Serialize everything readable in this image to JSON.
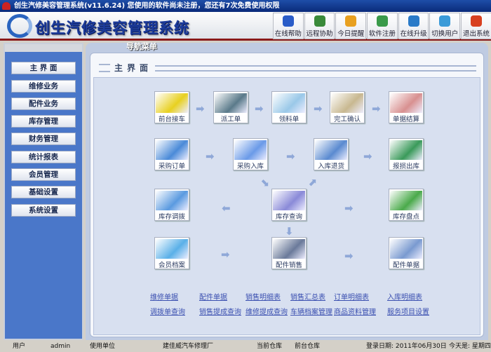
{
  "window": {
    "title": "创生汽修美容管理系统(v11.6.24)   您使用的软件尚未注册，您还有7次免费使用权限"
  },
  "header": {
    "logo_text": "创生汽修美容管理系统"
  },
  "toolbar": [
    {
      "label": "在线帮助",
      "icon": "help-icon",
      "color": "#2a5cc8"
    },
    {
      "label": "远程协助",
      "icon": "remote-computer-icon",
      "color": "#3a8a3a"
    },
    {
      "label": "今日提醒",
      "icon": "cake-icon",
      "color": "#e8a020"
    },
    {
      "label": "软件注册",
      "icon": "register-icon",
      "color": "#3a9a4a"
    },
    {
      "label": "在线升级",
      "icon": "upgrade-icon",
      "color": "#2a7ac8"
    },
    {
      "label": "切换用户",
      "icon": "users-icon",
      "color": "#3a9ad8"
    },
    {
      "label": "退出系统",
      "icon": "power-icon",
      "color": "#d84020"
    }
  ],
  "sidebar": {
    "title": "导航菜单",
    "items": [
      "主 界 面",
      "维修业务",
      "配件业务",
      "库存管理",
      "财务管理",
      "统计报表",
      "会员管理",
      "基础设置",
      "系统设置"
    ]
  },
  "main": {
    "title": "主界面",
    "modules": [
      {
        "label": "前台接车",
        "color": "#e8d020"
      },
      {
        "label": "派工单",
        "color": "#5a7a8a"
      },
      {
        "label": "领料单",
        "color": "#9ac8e8"
      },
      {
        "label": "完工确认",
        "color": "#c8b890"
      },
      {
        "label": "单据结算",
        "color": "#d89090"
      },
      {
        "label": "采购订单",
        "color": "#4a8ad8"
      },
      {
        "label": "采购入库",
        "color": "#6a9ae8"
      },
      {
        "label": "入库退货",
        "color": "#5a8ad0"
      },
      {
        "label": "报损出库",
        "color": "#3a9a5a"
      },
      {
        "label": "库存调拨",
        "color": "#5a9ae0"
      },
      {
        "label": "库存查询",
        "color": "#8a8ad8"
      },
      {
        "label": "库存盘点",
        "color": "#4aaa4a"
      },
      {
        "label": "会员档案",
        "color": "#5ab0e8"
      },
      {
        "label": "配件销售",
        "color": "#6a7a9a"
      },
      {
        "label": "配件单据",
        "color": "#7a9ad0"
      }
    ],
    "links": [
      "维修单据",
      "配件单据",
      "销售明细表",
      "销售汇总表",
      "订单明细表",
      "入库明细表",
      "调拨单查询",
      "销售提成查询",
      "维修提成查询",
      "车辆档案管理",
      "商品资料管理",
      "服务项目设置"
    ]
  },
  "status": {
    "user_label": "用户",
    "user": "admin",
    "unit_label": "使用单位",
    "unit": "建佳威汽车修理厂",
    "warehouse_label": "当前仓库",
    "warehouse": "前台仓库",
    "login_date": "登录日期: 2011年06月30日",
    "today": "今天是: 星期四"
  }
}
